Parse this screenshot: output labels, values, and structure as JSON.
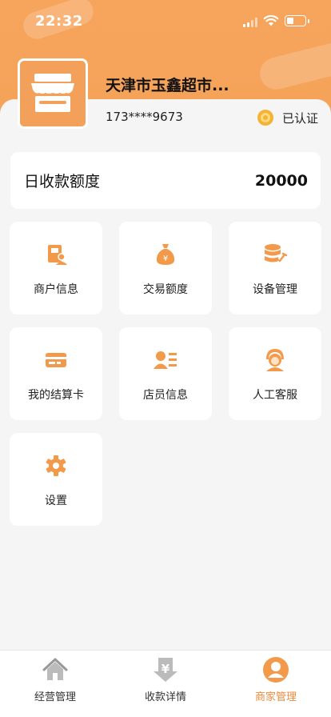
{
  "status_bar": {
    "time": "22:32"
  },
  "store": {
    "name": "天津市玉鑫超市...",
    "phone": "173****9673",
    "verified_label": "已认证"
  },
  "quota": {
    "label": "日收款额度",
    "value": "20000"
  },
  "menu": [
    {
      "label": "商户信息",
      "icon": "merchant-info-icon"
    },
    {
      "label": "交易额度",
      "icon": "money-bag-icon"
    },
    {
      "label": "设备管理",
      "icon": "device-database-icon"
    },
    {
      "label": "我的结算卡",
      "icon": "bank-card-icon"
    },
    {
      "label": "店员信息",
      "icon": "staff-card-icon"
    },
    {
      "label": "人工客服",
      "icon": "customer-service-icon"
    },
    {
      "label": "设置",
      "icon": "gear-icon"
    }
  ],
  "tabbar": [
    {
      "label": "经营管理",
      "icon": "home-icon"
    },
    {
      "label": "收款详情",
      "icon": "yen-down-icon"
    },
    {
      "label": "商家管理",
      "icon": "user-icon",
      "active": true
    }
  ],
  "colors": {
    "accent": "#f5a35a",
    "active_tab": "#f08a3c",
    "background": "#f5f5f5"
  }
}
